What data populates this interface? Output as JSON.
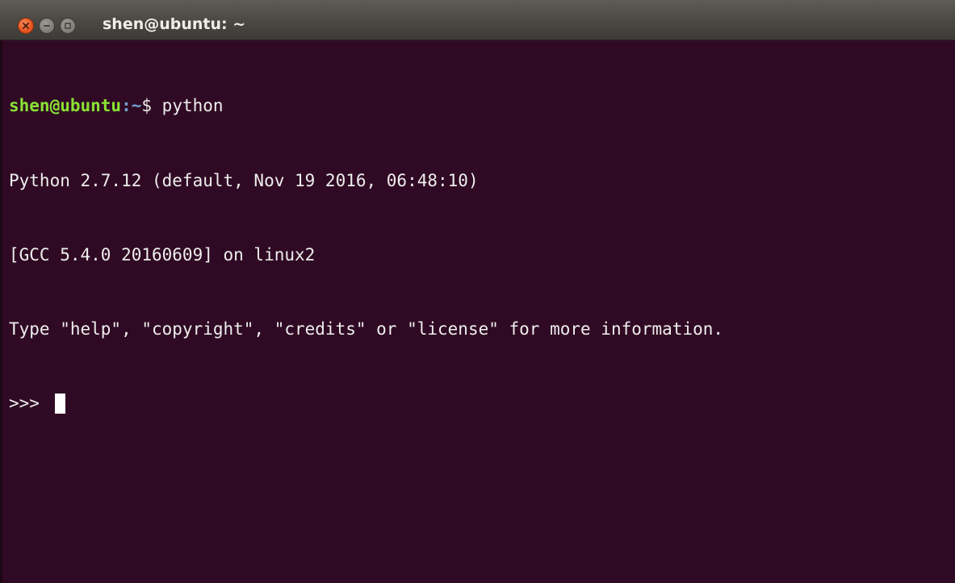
{
  "window": {
    "title": "shen@ubuntu: ~"
  },
  "terminal": {
    "prompt_user_host": "shen@ubuntu",
    "prompt_path": ":~",
    "prompt_suffix": "$ ",
    "command": "python",
    "output_lines": [
      "Python 2.7.12 (default, Nov 19 2016, 06:48:10)",
      "[GCC 5.4.0 20160609] on linux2",
      "Type \"help\", \"copyright\", \"credits\" or \"license\" for more information."
    ],
    "python_prompt": ">>> "
  },
  "colors": {
    "terminal_background": "#300a24",
    "prompt_user_color": "#8ae234",
    "prompt_path_color": "#729fcf",
    "close_button": "#e95420"
  },
  "icons": {
    "close": "close-icon",
    "minimize": "minimize-icon",
    "maximize": "maximize-icon"
  }
}
